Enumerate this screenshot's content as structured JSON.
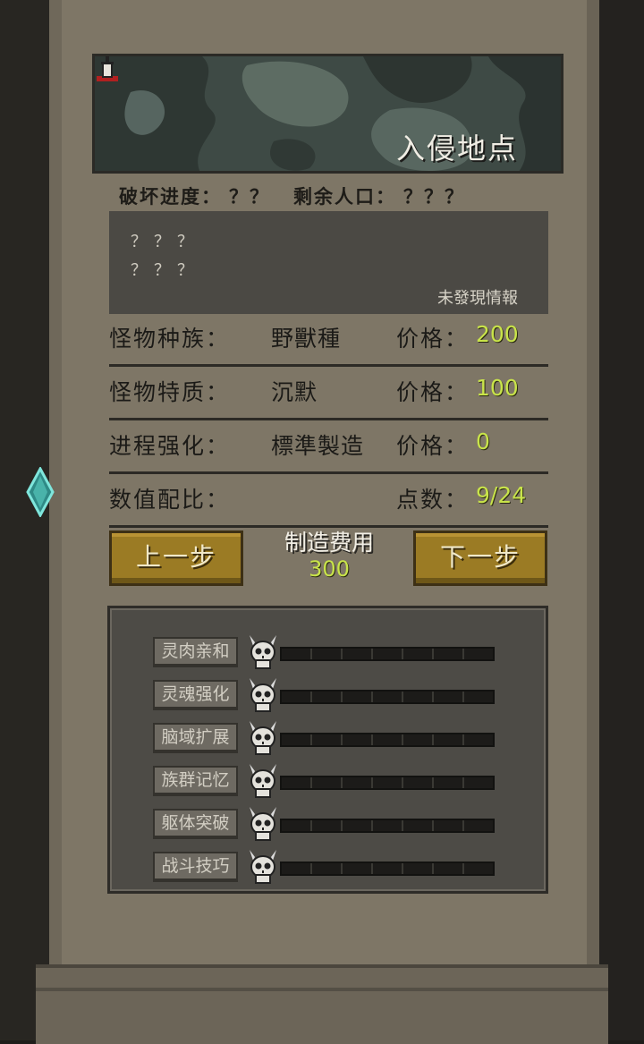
{
  "map": {
    "title": "入侵地点"
  },
  "stats": {
    "destroy_label": "破坏进度：",
    "destroy_value": "？？",
    "population_label": "剩余人口：",
    "population_value": "？？？"
  },
  "info": {
    "line1": "？？？",
    "line2": "？？？",
    "note": "未發現情報"
  },
  "rows": [
    {
      "label": "怪物种族：",
      "value": "野獸種",
      "price_label": "价格：",
      "price": "200"
    },
    {
      "label": "怪物特质：",
      "value": "沉默",
      "price_label": "价格：",
      "price": "100"
    },
    {
      "label": "进程强化：",
      "value": "標準製造",
      "price_label": "价格：",
      "price": "0"
    },
    {
      "label": "数值配比：",
      "value": "",
      "price_label": "点数：",
      "price": "9/24"
    }
  ],
  "buttons": {
    "prev": "上一步",
    "next": "下一步"
  },
  "cost": {
    "label": "制造费用",
    "value": "300"
  },
  "attributes": [
    {
      "label": "灵肉亲和",
      "level": 0,
      "max": 7
    },
    {
      "label": "灵魂强化",
      "level": 0,
      "max": 7
    },
    {
      "label": "脑域扩展",
      "level": 0,
      "max": 7
    },
    {
      "label": "族群记忆",
      "level": 0,
      "max": 7
    },
    {
      "label": "躯体突破",
      "level": 0,
      "max": 7
    },
    {
      "label": "战斗技巧",
      "level": 0,
      "max": 7
    }
  ],
  "colors": {
    "price_value": "#c9e44a",
    "button": "#9b7b24",
    "panel": "#4d4b46",
    "parchment": "#7e7666"
  },
  "icons": {
    "marker": "tower-marker-icon",
    "skull": "skull-icon",
    "gem": "crystal-icon"
  }
}
